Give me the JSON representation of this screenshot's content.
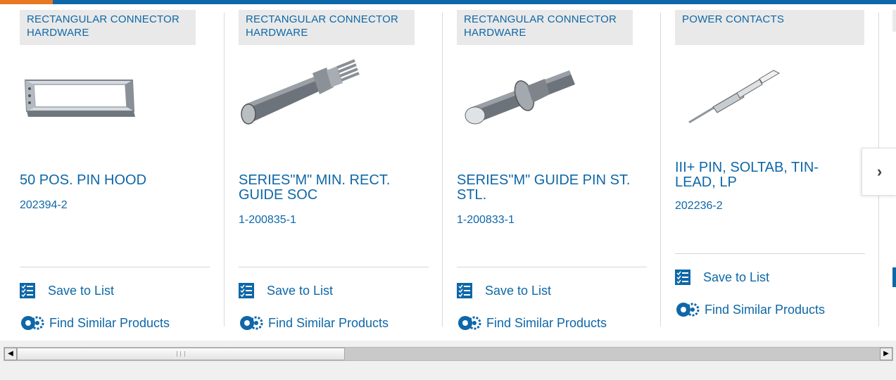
{
  "cards": [
    {
      "category": "RECTANGULAR CONNECTOR HARDWARE",
      "title": "50 POS. PIN HOOD",
      "part_number": "202394-2",
      "save_label": "Save to List",
      "similar_label": "Find Similar Products",
      "image_icon": "pin-hood-image"
    },
    {
      "category": "RECTANGULAR CONNECTOR HARDWARE",
      "title": "SERIES\"M\" MIN. RECT. GUIDE SOC",
      "part_number": "1-200835-1",
      "save_label": "Save to List",
      "similar_label": "Find Similar Products",
      "image_icon": "guide-socket-image"
    },
    {
      "category": "RECTANGULAR CONNECTOR HARDWARE",
      "title": "SERIES\"M\" GUIDE PIN ST. STL.",
      "part_number": "1-200833-1",
      "save_label": "Save to List",
      "similar_label": "Find Similar Products",
      "image_icon": "guide-pin-image"
    },
    {
      "category": "POWER CONTACTS",
      "title": "III+ PIN, SOLTAB, TIN-LEAD, LP",
      "part_number": "202236-2",
      "save_label": "Save to List",
      "similar_label": "Find Similar Products",
      "image_icon": "power-contact-pin-image"
    }
  ],
  "carousel": {
    "next_icon": "chevron-right-icon",
    "next_glyph": "›"
  },
  "scrollbar": {
    "left_glyph": "◀",
    "right_glyph": "▶"
  },
  "colors": {
    "link": "#0e67a8",
    "category_bg": "#e9e9e9",
    "top_bar": "#0e67a8",
    "top_accent": "#e87722"
  }
}
